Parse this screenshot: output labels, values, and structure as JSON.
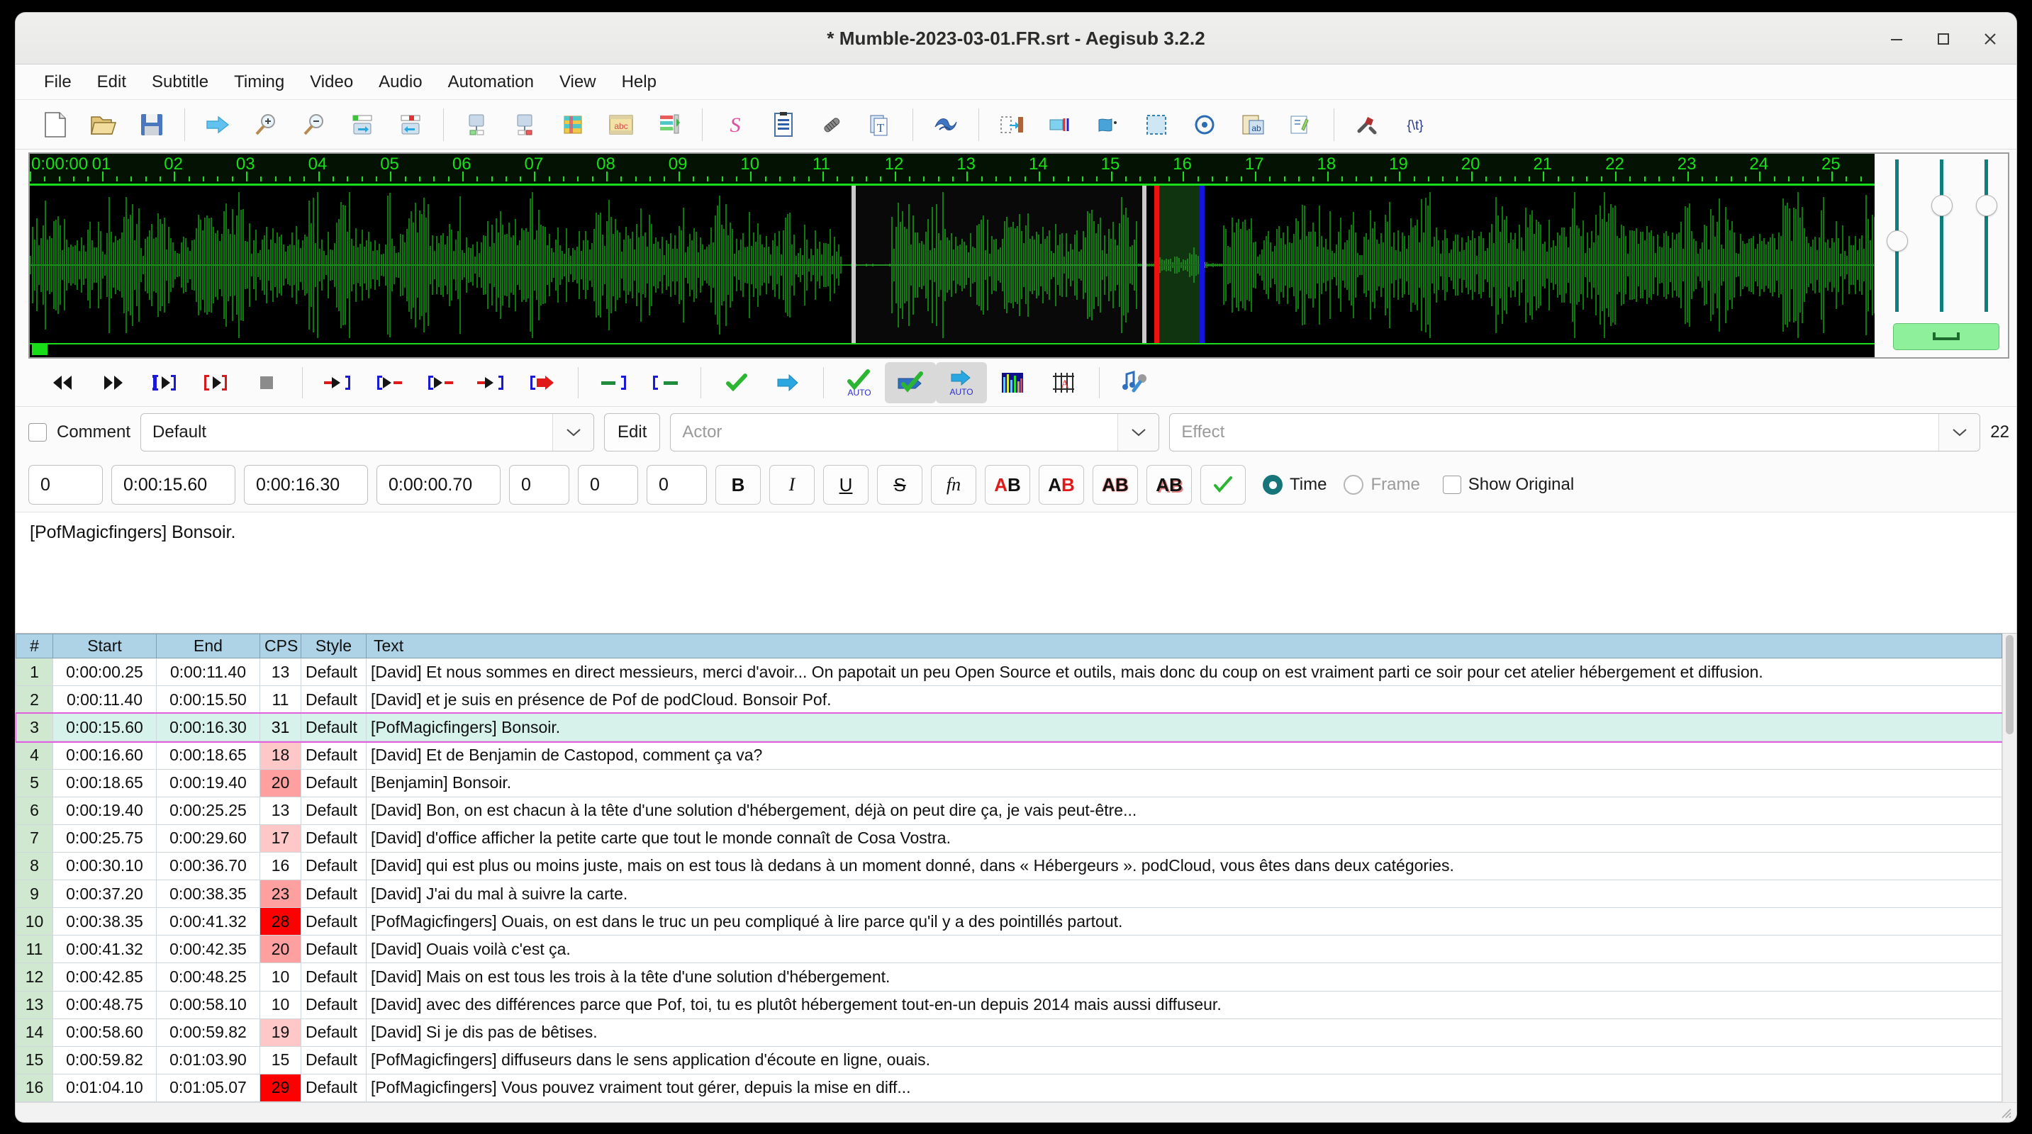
{
  "window": {
    "title": "* Mumble-2023-03-01.FR.srt - Aegisub 3.2.2",
    "minimize_label": "minimize",
    "maximize_label": "maximize",
    "close_label": "close"
  },
  "menubar": {
    "items": [
      {
        "label": "File"
      },
      {
        "label": "Edit"
      },
      {
        "label": "Subtitle"
      },
      {
        "label": "Timing"
      },
      {
        "label": "Video"
      },
      {
        "label": "Audio"
      },
      {
        "label": "Automation"
      },
      {
        "label": "View"
      },
      {
        "label": "Help"
      }
    ]
  },
  "toolbar": {
    "groups": [
      [
        "new-subtitles-icon",
        "open-subtitles-icon",
        "save-subtitles-icon"
      ],
      [
        "jump-to-icon",
        "zoom-in-icon",
        "zoom-out-icon",
        "shift-times-forward-icon",
        "shift-times-back-icon"
      ],
      [
        "properties-before-icon",
        "properties-after-icon",
        "styles-manager-icon",
        "attachments-film-icon",
        "timing-postprocessor-icon"
      ],
      [
        "spell-checker-icon",
        "translation-assistant-icon",
        "attachments-icon",
        "fonts-collector-icon"
      ],
      [
        "resample-icon"
      ],
      [
        "shift-by-time-icon",
        "snap-start-to-video-icon",
        "snap-end-to-video-icon",
        "select-visible-icon",
        "cycle-active-line-icon",
        "paste-over-icon",
        "styling-assistant-icon"
      ],
      [
        "options-icon",
        "tags-icon"
      ]
    ]
  },
  "audio": {
    "ruler_labels": [
      "0:00:00",
      "01",
      "02",
      "03",
      "04",
      "05",
      "06",
      "07",
      "08",
      "09",
      "10",
      "11",
      "12",
      "13",
      "14",
      "15",
      "16",
      "17",
      "18",
      "19",
      "20",
      "21",
      "22",
      "23",
      "24",
      "25"
    ],
    "selection_start_seconds": 15.6,
    "selection_end_seconds": 16.3,
    "inactive_region_start_seconds": 11.4,
    "inactive_region_end_seconds": 15.5,
    "view_start_seconds": 0,
    "view_end_seconds": 25.6
  },
  "transport": {
    "buttons": [
      {
        "name": "play-previous-line-icon",
        "label": "Play previous line",
        "toggled": false
      },
      {
        "name": "play-next-line-icon",
        "label": "Play next line",
        "toggled": false
      },
      {
        "name": "play-selection-icon",
        "label": "Play current line",
        "toggled": false
      },
      {
        "name": "play-original-line-icon",
        "label": "Play original line",
        "toggled": false
      },
      {
        "name": "stop-playback-icon",
        "label": "Stop playback",
        "toggled": false
      },
      {
        "name": "play-500ms-before-start-icon",
        "label": "Play 500 ms before selection start",
        "toggled": false
      },
      {
        "name": "play-500ms-after-start-icon",
        "label": "Play 500 ms after selection start",
        "toggled": false
      },
      {
        "name": "play-500ms-before-end-icon",
        "label": "Play 500 ms before selection end",
        "toggled": false
      },
      {
        "name": "play-500ms-after-end-icon",
        "label": "Play 500 ms after selection end",
        "toggled": false
      },
      {
        "name": "play-to-end-of-file-icon",
        "label": "Play from selection start to end of file",
        "toggled": false
      },
      {
        "name": "commit-and-go-next-icon",
        "label": "Commit",
        "toggled": false
      },
      {
        "name": "go-to-selection-icon",
        "label": "Go to selection",
        "toggled": false
      },
      {
        "name": "auto-commit-icon",
        "label": "Automatically commit all changes",
        "toggled": false
      },
      {
        "name": "commit-on-next-icon",
        "label": "Auto goes to next line on commit",
        "toggled": true
      },
      {
        "name": "auto-scroll-icon",
        "label": "Auto scroll audio display to selected line",
        "toggled": true
      },
      {
        "name": "spectrum-analyzer-icon",
        "label": "Spectrum analyzer mode",
        "toggled": false
      },
      {
        "name": "keyframes-icon",
        "label": "Show keyframes in slider",
        "toggled": false
      },
      {
        "name": "karaoke-mode-icon",
        "label": "Karaoke mode",
        "toggled": false
      }
    ]
  },
  "style_row": {
    "comment_label": "Comment",
    "comment_checked": false,
    "style_value": "Default",
    "edit_label": "Edit",
    "actor_placeholder": "Actor",
    "actor_value": "",
    "effect_placeholder": "Effect",
    "effect_value": "",
    "trailing_value": "22"
  },
  "timing_row": {
    "layer": "0",
    "start_time": "0:00:15.60",
    "end_time": "0:00:16.30",
    "duration": "0:00:00.70",
    "margin_left": "0",
    "margin_right": "0",
    "margin_vertical": "0",
    "format_buttons": [
      {
        "name": "bold-button",
        "label": "B"
      },
      {
        "name": "italic-button",
        "label": "I"
      },
      {
        "name": "underline-button",
        "label": "U"
      },
      {
        "name": "strikeout-button",
        "label": "S"
      },
      {
        "name": "font-select-button",
        "label": "fn"
      },
      {
        "name": "primary-color-button",
        "label": "AB"
      },
      {
        "name": "secondary-color-button",
        "label": "AB"
      },
      {
        "name": "outline-color-button",
        "label": "AB"
      },
      {
        "name": "shadow-color-button",
        "label": "AB"
      },
      {
        "name": "commit-button",
        "label": "✓"
      }
    ],
    "time_radio_label": "Time",
    "frame_radio_label": "Frame",
    "time_selected": true,
    "show_original_label": "Show Original",
    "show_original_checked": false
  },
  "text_editor": {
    "value": "[PofMagicfingers] Bonsoir."
  },
  "grid": {
    "columns": [
      "#",
      "Start",
      "End",
      "CPS",
      "Style",
      "Text"
    ],
    "selected_row_index": 2,
    "rows": [
      {
        "num": "1",
        "start": "0:00:00.25",
        "end": "0:00:11.40",
        "cps": "13",
        "cps_level": "none",
        "style": "Default",
        "text": "[David] Et nous sommes en direct messieurs, merci d'avoir... On papotait un peu Open Source et outils, mais donc du coup on est vraiment parti ce soir pour cet atelier hébergement et diffusion."
      },
      {
        "num": "2",
        "start": "0:00:11.40",
        "end": "0:00:15.50",
        "cps": "11",
        "cps_level": "none",
        "style": "Default",
        "text": "[David] et je suis en présence de Pof de podCloud. Bonsoir Pof."
      },
      {
        "num": "3",
        "start": "0:00:15.60",
        "end": "0:00:16.30",
        "cps": "31",
        "cps_level": "high",
        "style": "Default",
        "text": "[PofMagicfingers] Bonsoir."
      },
      {
        "num": "4",
        "start": "0:00:16.60",
        "end": "0:00:18.65",
        "cps": "18",
        "cps_level": "low",
        "style": "Default",
        "text": "[David] Et de Benjamin de Castopod, comment ça va?"
      },
      {
        "num": "5",
        "start": "0:00:18.65",
        "end": "0:00:19.40",
        "cps": "20",
        "cps_level": "mid",
        "style": "Default",
        "text": "[Benjamin] Bonsoir."
      },
      {
        "num": "6",
        "start": "0:00:19.40",
        "end": "0:00:25.25",
        "cps": "13",
        "cps_level": "none",
        "style": "Default",
        "text": "[David] Bon, on est chacun à la tête d'une solution d'hébergement, déjà on peut dire ça, je vais peut-être..."
      },
      {
        "num": "7",
        "start": "0:00:25.75",
        "end": "0:00:29.60",
        "cps": "17",
        "cps_level": "low",
        "style": "Default",
        "text": "[David] d'office afficher la petite carte que tout le monde connaît de Cosa Vostra."
      },
      {
        "num": "8",
        "start": "0:00:30.10",
        "end": "0:00:36.70",
        "cps": "16",
        "cps_level": "none",
        "style": "Default",
        "text": "[David] qui est plus ou moins juste, mais on est tous là dedans à un moment donné, dans « Hébergeurs ». podCloud, vous êtes dans deux catégories."
      },
      {
        "num": "9",
        "start": "0:00:37.20",
        "end": "0:00:38.35",
        "cps": "23",
        "cps_level": "mid",
        "style": "Default",
        "text": "[David] J'ai du mal à suivre la carte."
      },
      {
        "num": "10",
        "start": "0:00:38.35",
        "end": "0:00:41.32",
        "cps": "28",
        "cps_level": "high",
        "style": "Default",
        "text": "[PofMagicfingers] Ouais, on est dans le truc un peu compliqué à lire parce qu'il y a des pointillés partout."
      },
      {
        "num": "11",
        "start": "0:00:41.32",
        "end": "0:00:42.35",
        "cps": "20",
        "cps_level": "mid",
        "style": "Default",
        "text": "[David] Ouais voilà c'est ça."
      },
      {
        "num": "12",
        "start": "0:00:42.85",
        "end": "0:00:48.25",
        "cps": "10",
        "cps_level": "none",
        "style": "Default",
        "text": "[David] Mais on est tous les trois à la tête d'une solution d'hébergement."
      },
      {
        "num": "13",
        "start": "0:00:48.75",
        "end": "0:00:58.10",
        "cps": "10",
        "cps_level": "none",
        "style": "Default",
        "text": "[David] avec des différences parce que Pof, toi, tu es plutôt hébergement tout-en-un depuis 2014 mais aussi diffuseur."
      },
      {
        "num": "14",
        "start": "0:00:58.60",
        "end": "0:00:59.82",
        "cps": "19",
        "cps_level": "low",
        "style": "Default",
        "text": "[David] Si je dis pas de bêtises."
      },
      {
        "num": "15",
        "start": "0:00:59.82",
        "end": "0:01:03.90",
        "cps": "15",
        "cps_level": "none",
        "style": "Default",
        "text": "[PofMagicfingers] diffuseurs dans le sens application d'écoute en ligne, ouais."
      },
      {
        "num": "16",
        "start": "0:01:04.10",
        "end": "0:01:05.07",
        "cps": "29",
        "cps_level": "high",
        "style": "Default",
        "text": "[PofMagicfingers] Vous pouvez vraiment tout gérer, depuis la mise en diff..."
      }
    ]
  },
  "colors": {
    "header_bg": "#aed2e6",
    "row_num_bg": "#cfe8cf",
    "selected_row_bg": "#d6f2ea",
    "selected_row_outline": "#e060e0",
    "cps_high": "#ff0000",
    "cps_mid": "#ffa0a0",
    "cps_low": "#ffc8c8",
    "waveform_green": "#0a7a0a",
    "waveform_selected_green": "#23e023",
    "ruler_green": "#17e017",
    "selection_start_marker": "#ee1111",
    "selection_end_marker": "#1414dd",
    "accent_teal": "#17757a"
  }
}
